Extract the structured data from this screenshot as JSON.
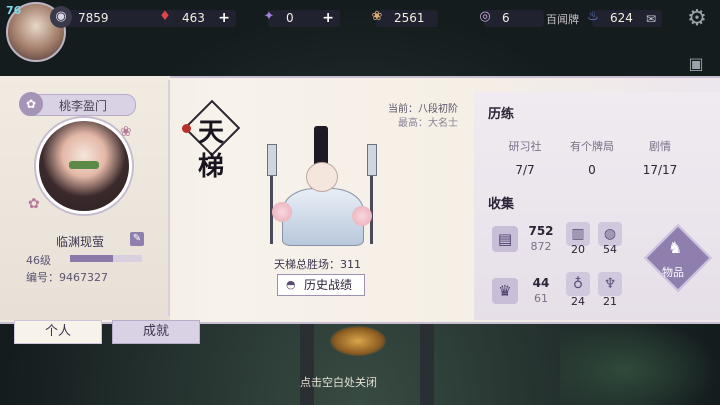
{
  "hud": {
    "fps": "76",
    "resources": [
      {
        "icon": "jade-icon",
        "value": "7859",
        "plus": ""
      },
      {
        "icon": "heart-gem-icon",
        "value": "463",
        "plus": "+"
      },
      {
        "icon": "purple-scroll-icon",
        "value": "0",
        "plus": "+"
      },
      {
        "icon": "food-icon",
        "value": "2561",
        "plus": ""
      },
      {
        "icon": "orb-icon",
        "value": "6",
        "plus": ""
      },
      {
        "icon": "flame-icon",
        "value": "624",
        "plus": ""
      }
    ],
    "hundred_ghost_label": "百闻牌"
  },
  "profile": {
    "guild": "桃李盈门",
    "name": "临渊现萤",
    "level": "46级",
    "level_progress": 0.6,
    "uid": "编号：9467327"
  },
  "tabs": {
    "personal": "个人",
    "achievement": "成就"
  },
  "ladder": {
    "emblem_top": "天",
    "emblem_bottom": "梯",
    "current_rank": "当前：八段初阶",
    "highest_rank": "最高：大名士",
    "total_wins": "天梯总胜场：311",
    "history_button": "历史战绩"
  },
  "training": {
    "title": "历练",
    "stats": [
      {
        "label": "研习社",
        "value": "7/7"
      },
      {
        "label": "有个牌局",
        "value": "0"
      },
      {
        "label": "剧情",
        "value": "17/17"
      }
    ]
  },
  "collection": {
    "title": "收集",
    "rows": [
      {
        "main_value": "752",
        "main_total": "872",
        "a": "20",
        "b": "54"
      },
      {
        "main_value": "44",
        "main_total": "61",
        "a": "24",
        "b": "21"
      }
    ],
    "items_label": "物品"
  },
  "footer": {
    "hint": "点击空白处关闭"
  },
  "colors": {
    "accent": "#8f7fae",
    "panel": "#f5efe6",
    "hud_bg": "#232332"
  }
}
